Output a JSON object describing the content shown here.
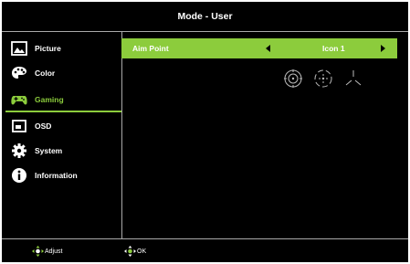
{
  "title": "Mode - User",
  "menu": [
    {
      "label": "Picture",
      "icon": "picture-icon"
    },
    {
      "label": "Color",
      "icon": "palette-icon"
    },
    {
      "label": "Gaming",
      "icon": "gamepad-icon",
      "active": true
    },
    {
      "label": "OSD",
      "icon": "osd-icon"
    },
    {
      "label": "System",
      "icon": "gear-icon"
    },
    {
      "label": "Information",
      "icon": "info-icon"
    }
  ],
  "aim_point": {
    "label": "Aim Point",
    "value": "Icon 1"
  },
  "aim_icons": [
    "crosshair-circle-icon",
    "crosshair-dashed-icon",
    "crosshair-tri-icon"
  ],
  "footer": {
    "adjust_label": "Adjust",
    "ok_label": "OK"
  },
  "colors": {
    "accent": "#8ccc3c",
    "background": "#000000",
    "text": "#ffffff",
    "divider": "#a9a9a9"
  }
}
